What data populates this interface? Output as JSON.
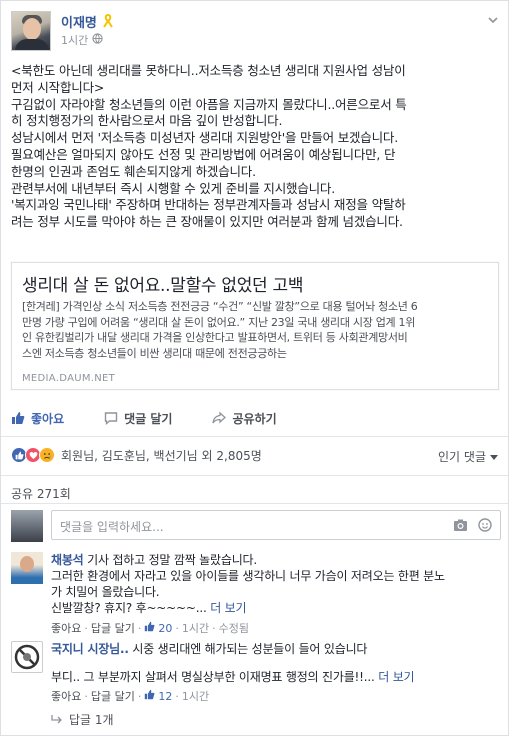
{
  "post": {
    "author": "이재명",
    "time": "1시간",
    "body_lines": [
      "<북한도 아닌데 생리대를 못하다니..저소득층 청소년 생리대 지원사업 성남이",
      "먼저 시작합니다>",
      "구김없이 자라야할 청소년들의 이런 아픔을 지금까지 몰랐다니..어른으로서 특",
      "히 정치행정가의 한사람으로서 마음 깊이 반성합니다.",
      "성남시에서 먼저 '저소득층 미성년자 생리대 지원방안'을 만들어 보겠습니다.",
      "필요예산은 얼마되지 않아도 선정 및 관리방법에 어려움이 예상됩니다만, 단",
      "한명의 인권과 존엄도 훼손되지않게 하겠습니다.",
      "관련부서에 내년부터 즉시 시행할 수 있게 준비를 지시했습니다.",
      "'복지과잉 국민나태' 주장하며 반대하는 정부관계자들과 성남시 재정을 약탈하",
      "려는 정부 시도를 막아야 하는 큰 장애물이 있지만 여러분과 함께 넘겠습니다."
    ]
  },
  "link": {
    "title": "생리대 살 돈 없어요..말할수 없었던 고백",
    "desc_lines": [
      "[한겨레] 가격인상 소식 저소득층 전전긍긍 “수건” “신발 깔창”으로 대용 털어놔 청소년 6",
      "만명 가량 구입에 어려움 “생리대 살 돈이 없어요.” 지난 23일 국내 생리대 시장 업계 1위",
      "인 유한킴벌리가 내달 생리대 가격을 인상한다고 발표하면서, 트위터 등 사회관계망서비",
      "스엔 저소득층 청소년들이 비싼 생리대 때문에 전전긍긍하는"
    ],
    "source": "MEDIA.DAUM.NET"
  },
  "actions": {
    "like": "좋아요",
    "comment": "댓글 달기",
    "share": "공유하기"
  },
  "reactions": {
    "names": "회원님, 김도훈님, 백선기님 외 2,805명",
    "sort": "인기 댓글"
  },
  "shares": "공유 271회",
  "comment_input": {
    "placeholder": "댓글을 입력하세요..."
  },
  "comments": [
    {
      "name": "채봉석",
      "lines": [
        "기사 접하고 정말 깜짝 놀랐습니다.",
        "그러한 환경에서 자라고 있을 아이들를 생각하니 너무 가슴이 저려오는 한편 분노",
        "가 치밀어 올랐습니다.",
        "신발깔창? 휴지? 후~~~~~..."
      ],
      "more": "더 보기",
      "like": "좋아요",
      "reply": "답글 달기",
      "likes": "20",
      "time": "1시간",
      "edited": "수정됨"
    },
    {
      "name": "국지니 시장님..",
      "lines": [
        "시중 생리대엔 해가되는 성분들이 들어 있습니다",
        "",
        "부디.. 그 부분까지 살펴서 명실상부한 이재명표 행정의 진가를!!..."
      ],
      "more": "더 보기",
      "like": "좋아요",
      "reply": "답글 달기",
      "likes": "12",
      "time": "1시간"
    }
  ],
  "reply_count": "답글 1개"
}
